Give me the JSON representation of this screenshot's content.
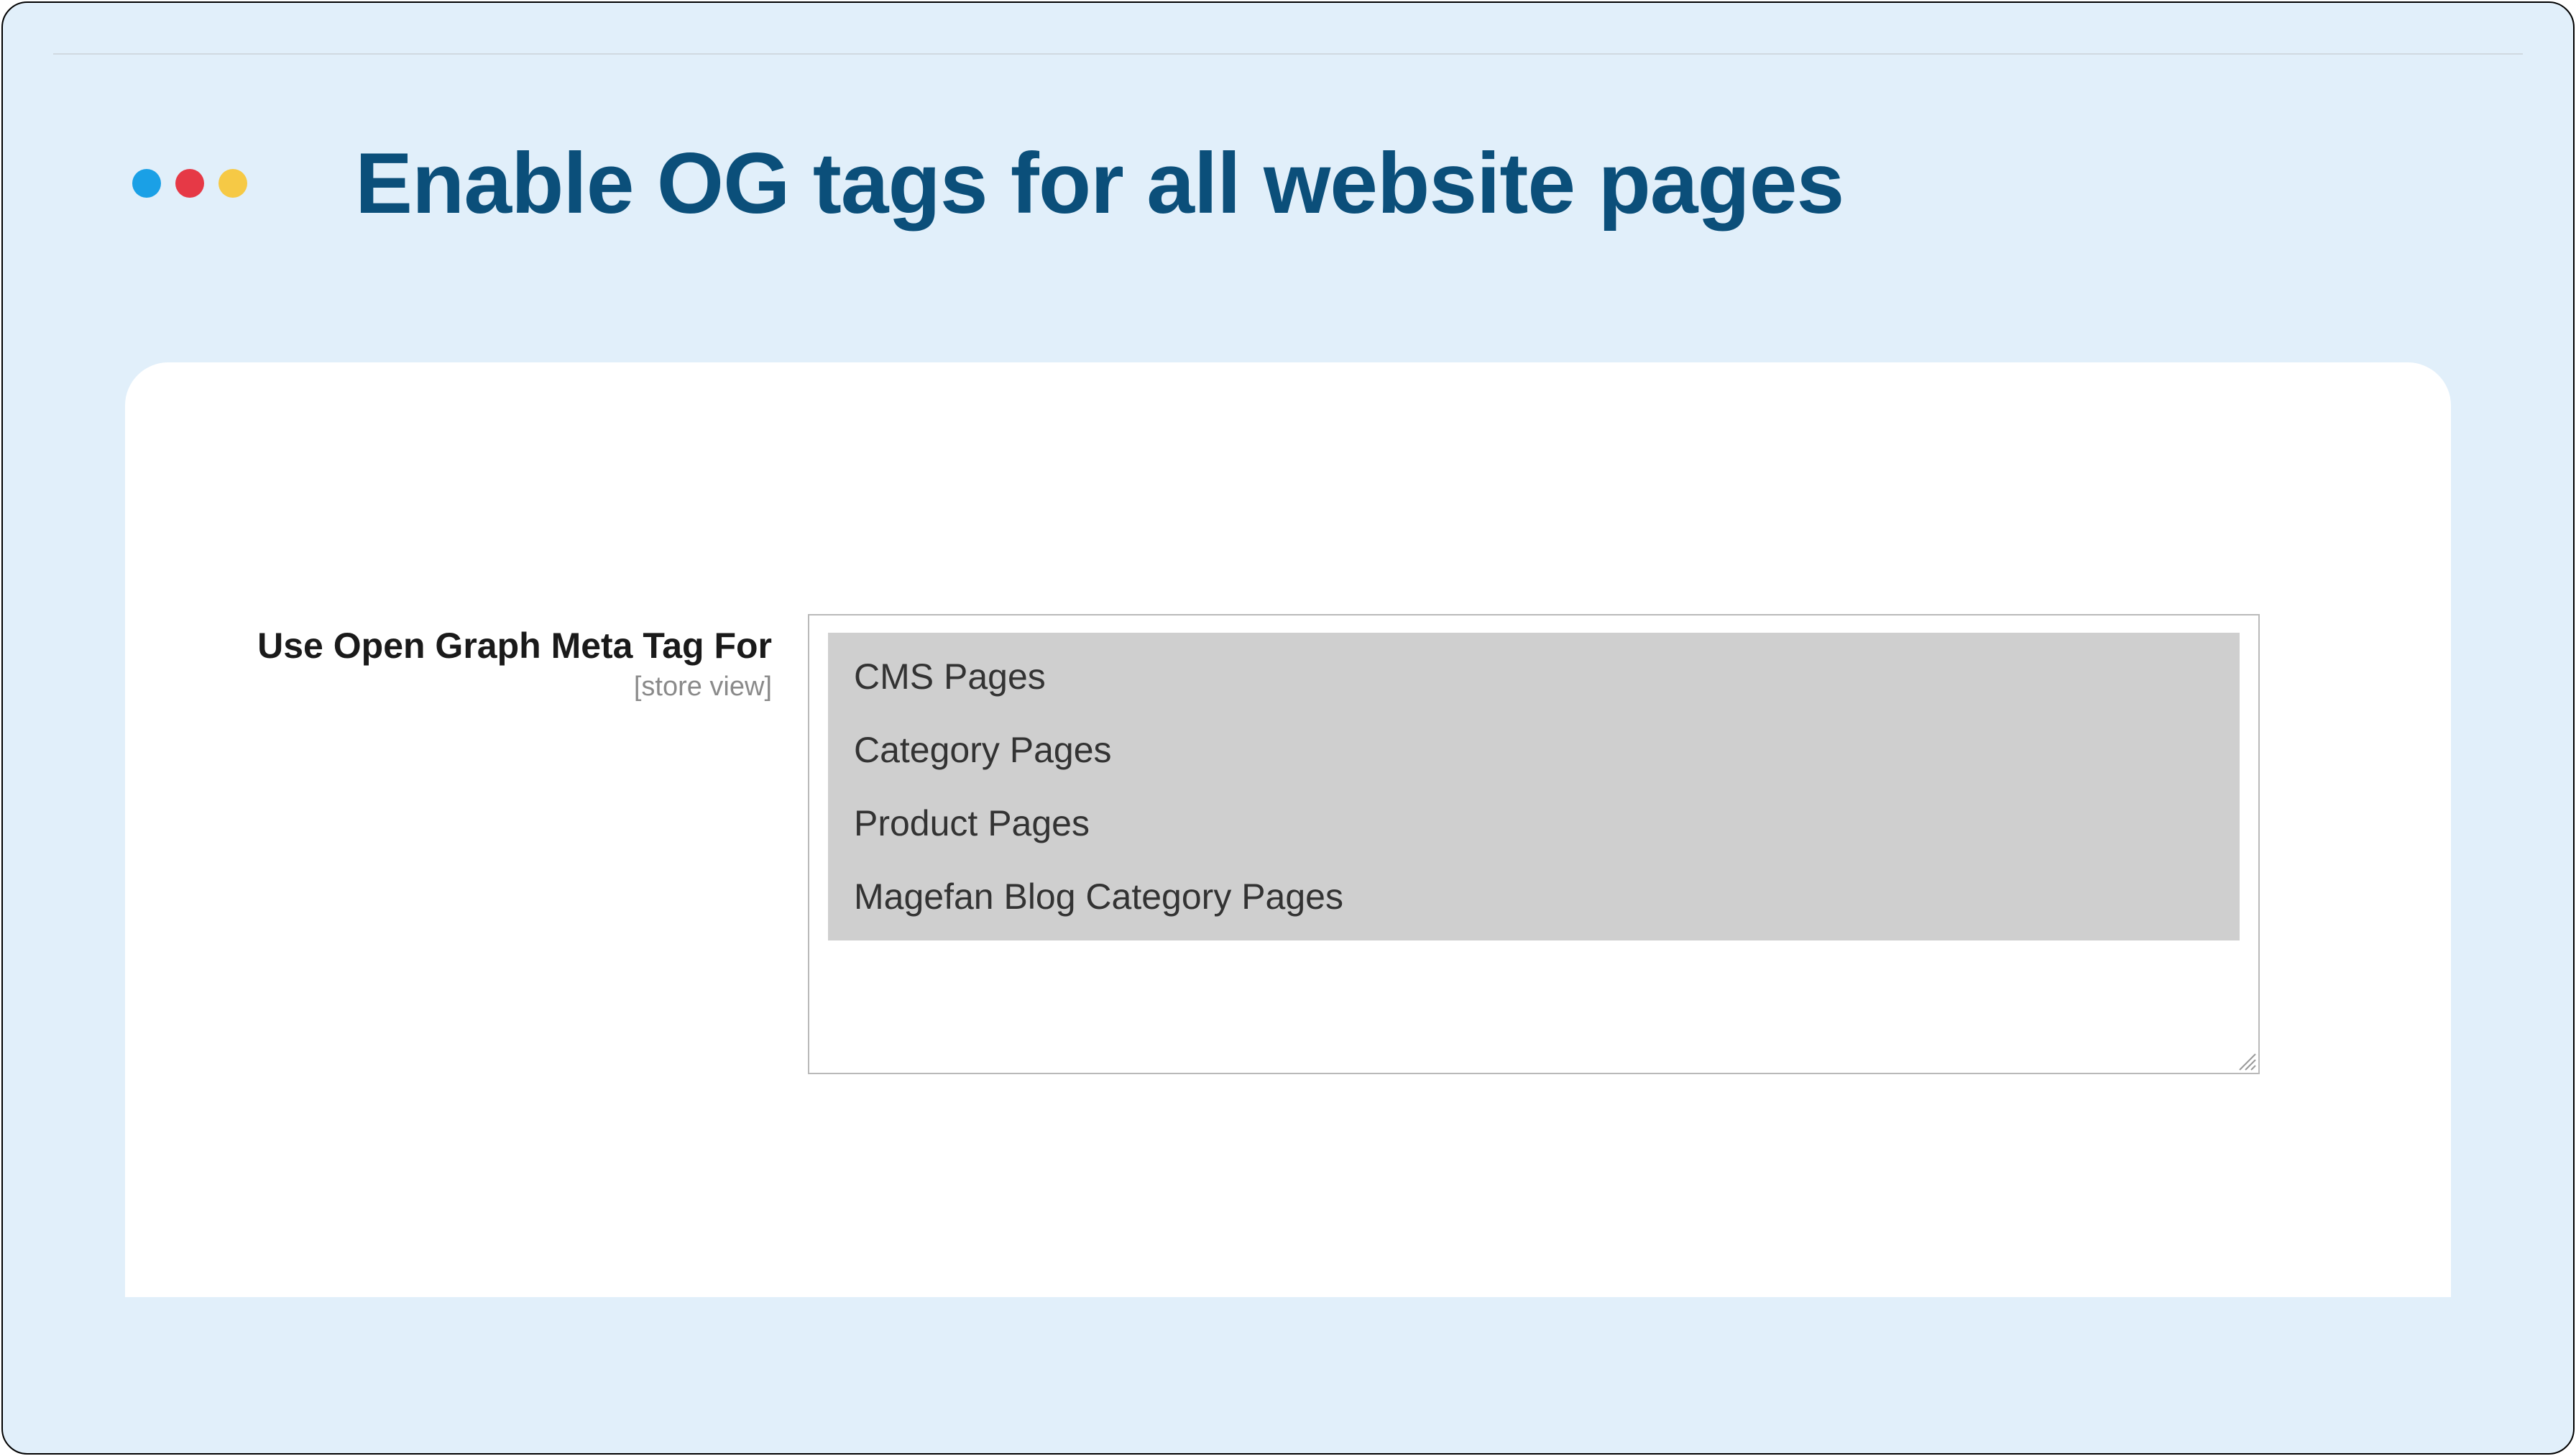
{
  "header": {
    "title": "Enable OG tags for all website pages"
  },
  "form": {
    "og_field": {
      "label": "Use Open Graph Meta Tag For",
      "scope": "[store view]",
      "options": [
        "CMS Pages",
        "Category Pages",
        "Product Pages",
        "Magefan Blog Category Pages"
      ]
    }
  }
}
